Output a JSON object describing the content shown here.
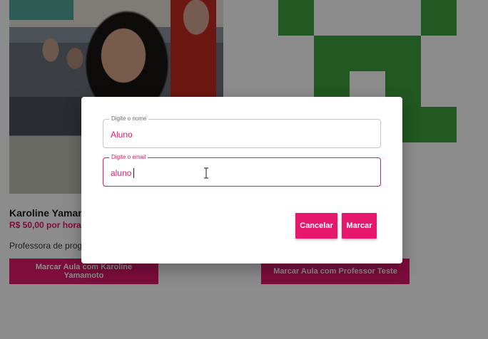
{
  "cards": [
    {
      "name": "Karoline Yamamoto",
      "name_shown": "Karoline Yamam",
      "price": "R$ 50,00 por hora",
      "description_visible": "Professora de prog",
      "book_button": "Marcar Aula com Karoline Yamamoto"
    },
    {
      "book_button": "Marcar Aula com Professor Teste",
      "avatar_color": "#3fa03f"
    }
  ],
  "dialog": {
    "name_field": {
      "label": "Digite o nome",
      "value": "Aluno"
    },
    "email_field": {
      "label": "Digite o email",
      "value": "aluno"
    },
    "cancel_label": "Cancelar",
    "confirm_label": "Marcar"
  },
  "colors": {
    "accent": "#e6186d",
    "overlay": "rgba(0,0,0,0.45)",
    "avatar_green": "#3fa03f"
  }
}
